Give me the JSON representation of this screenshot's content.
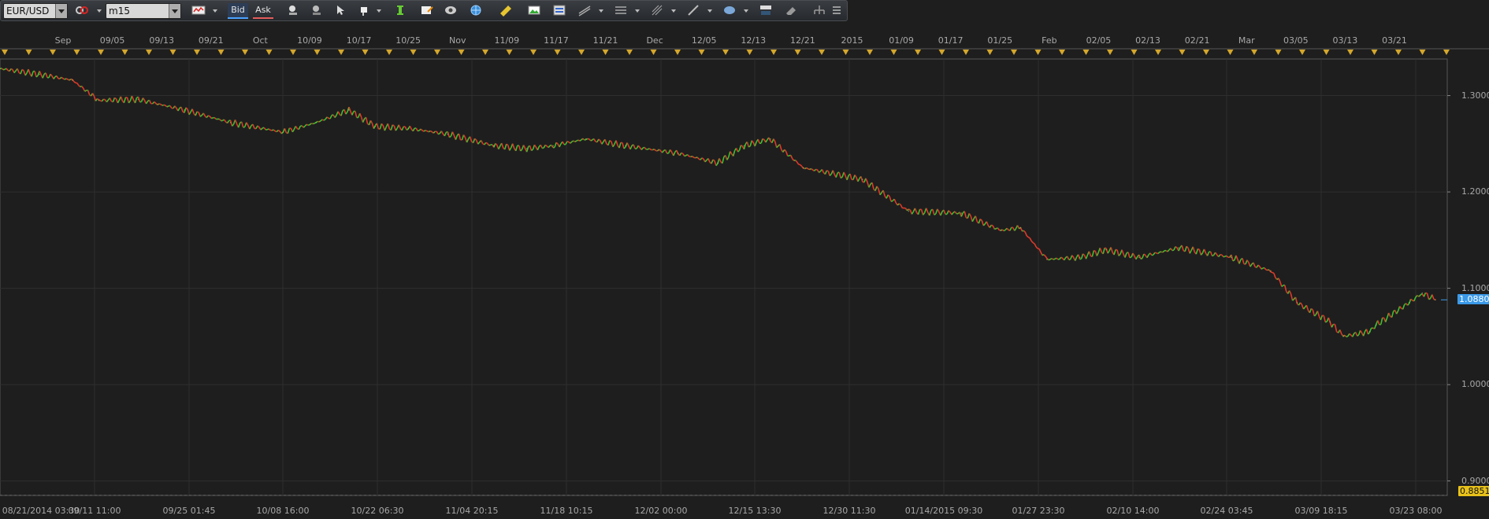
{
  "toolbar": {
    "symbol_value": "EUR/USD",
    "timeframe_value": "m15",
    "bid_label": "Bid",
    "ask_label": "Ask",
    "icons": [
      "link-icon",
      "chart-type-icon",
      "bid-ask-toggle",
      "zoom-in-icon",
      "zoom-out-icon",
      "cursor-icon",
      "crosshair-icon",
      "indicator-icon",
      "template-icon",
      "eye-icon",
      "globe-icon",
      "ruler-icon",
      "image-icon",
      "layout-icon",
      "trendline-icon",
      "channel-icon",
      "fibonacci-icon",
      "pen-icon",
      "ellipse-icon",
      "text-icon",
      "eraser-icon",
      "tree-icon",
      "menu-icon"
    ]
  },
  "time_axis_top": [
    "Sep",
    "09/05",
    "09/13",
    "09/21",
    "Oct",
    "10/09",
    "10/17",
    "10/25",
    "Nov",
    "11/09",
    "11/17",
    "11/21",
    "Dec",
    "12/05",
    "12/13",
    "12/21",
    "2015",
    "01/09",
    "01/17",
    "01/25",
    "Feb",
    "02/05",
    "02/13",
    "02/21",
    "Mar",
    "03/05",
    "03/13",
    "03/21"
  ],
  "time_axis_bottom": [
    "08/21/2014 03:30",
    "09/11 11:00",
    "09/25 01:45",
    "10/08 16:00",
    "10/22 06:30",
    "11/04 20:15",
    "11/18 10:15",
    "12/02 00:00",
    "12/15 13:30",
    "12/30 11:30",
    "01/14/2015 09:30",
    "01/27 23:30",
    "02/10 14:00",
    "02/24 03:45",
    "03/09 18:15",
    "03/23 08:00"
  ],
  "price_axis": [
    "1.3000",
    "1.2000",
    "1.1000",
    "1.0000",
    "0.9000"
  ],
  "current_price": "1.0880",
  "low_marker": "0.8851",
  "colors": {
    "up": "#3fbf2f",
    "down": "#e03a2a",
    "grid": "#2e2e2e",
    "current_price_bg": "#3a9ae8",
    "low_marker_bg": "#e8c21a",
    "marker_triangle": "#d4a72c"
  },
  "chart_data": {
    "type": "line",
    "title": "",
    "xlabel": "",
    "ylabel": "",
    "ylim": [
      0.885,
      1.338
    ],
    "series": [
      {
        "x": [
          "08/21/2014",
          "08/27/2014",
          "09/01/2014",
          "09/05/2014",
          "09/11/2014",
          "09/18/2014",
          "09/25/2014",
          "10/03/2014",
          "10/08/2014",
          "10/13/2014",
          "10/17/2014",
          "10/22/2014",
          "10/28/2014",
          "11/04/2014",
          "11/09/2014",
          "11/13/2014",
          "11/18/2014",
          "11/24/2014",
          "12/02/2014",
          "12/08/2014",
          "12/12/2014",
          "12/16/2014",
          "12/21/2014",
          "12/30/2014",
          "01/06/2015",
          "01/14/2015",
          "01/20/2015",
          "01/23/2015",
          "01/27/2015",
          "02/01/2015",
          "02/05/2015",
          "02/10/2015",
          "02/16/2015",
          "02/24/2015",
          "03/02/2015",
          "03/06/2015",
          "03/11/2015",
          "03/13/2015",
          "03/17/2015",
          "03/18/2015",
          "03/23/2015",
          "03/25/2015",
          "03/27/2015"
        ],
        "values": [
          1.328,
          1.322,
          1.316,
          1.295,
          1.296,
          1.285,
          1.272,
          1.262,
          1.272,
          1.285,
          1.268,
          1.266,
          1.26,
          1.248,
          1.245,
          1.248,
          1.255,
          1.248,
          1.24,
          1.23,
          1.248,
          1.255,
          1.225,
          1.213,
          1.18,
          1.178,
          1.16,
          1.163,
          1.13,
          1.132,
          1.14,
          1.132,
          1.142,
          1.132,
          1.118,
          1.085,
          1.065,
          1.05,
          1.055,
          1.062,
          1.085,
          1.095,
          1.088
        ]
      }
    ]
  }
}
